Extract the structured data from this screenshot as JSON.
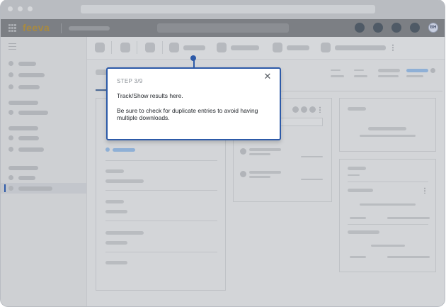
{
  "app": {
    "logo_text": "feeva",
    "avatar_initials": "BH"
  },
  "tooltip": {
    "step": "STEP 3/9",
    "title": "Track/Show results here.",
    "body": "Be sure to check for duplicate entries to avoid having multiple downloads.",
    "close_symbol": "✕"
  },
  "icons": {
    "apps": "grid-icon",
    "menu": "hamburger-icon",
    "close": "close-icon",
    "more": "kebab-icon"
  },
  "colors": {
    "accent": "#2d5aa8",
    "logo": "#a98a3f",
    "header_bg": "#7c7f84"
  }
}
